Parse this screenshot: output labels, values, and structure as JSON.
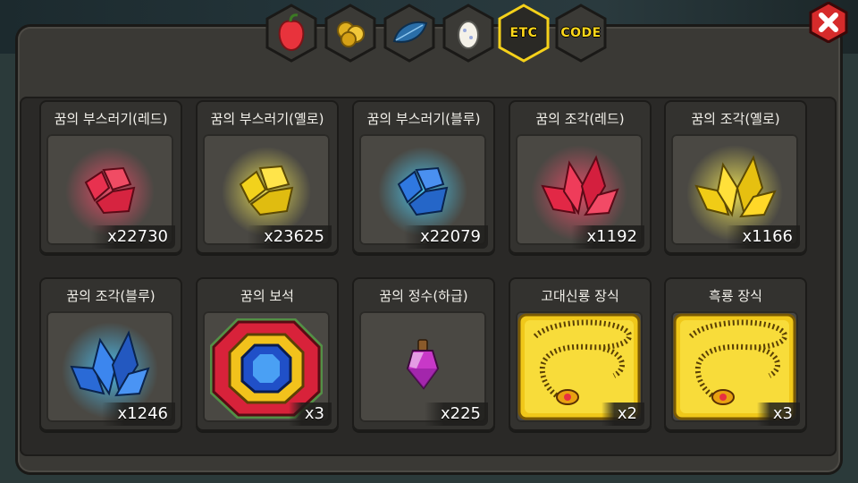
{
  "tabs": [
    {
      "name": "fruit",
      "label": ""
    },
    {
      "name": "gold-coins",
      "label": ""
    },
    {
      "name": "blue-feather",
      "label": ""
    },
    {
      "name": "egg",
      "label": ""
    },
    {
      "name": "etc",
      "label": "ETC",
      "active": true
    },
    {
      "name": "code",
      "label": "CODE"
    }
  ],
  "items": [
    {
      "title": "꿈의 부스러기(레드)",
      "count": "x22730",
      "icon": "red-shard-icon"
    },
    {
      "title": "꿈의 부스러기(옐로)",
      "count": "x23625",
      "icon": "yellow-shard-icon"
    },
    {
      "title": "꿈의 부스러기(블루)",
      "count": "x22079",
      "icon": "blue-shard-icon"
    },
    {
      "title": "꿈의 조각(레드)",
      "count": "x1192",
      "icon": "red-crystal-icon"
    },
    {
      "title": "꿈의 조각(옐로)",
      "count": "x1166",
      "icon": "yellow-crystal-icon"
    },
    {
      "title": "꿈의 조각(블루)",
      "count": "x1246",
      "icon": "blue-crystal-icon"
    },
    {
      "title": "꿈의 보석",
      "count": "x3",
      "icon": "jewel-icon"
    },
    {
      "title": "꿈의 정수(하급)",
      "count": "x225",
      "icon": "potion-icon"
    },
    {
      "title": "고대신룡 장식",
      "count": "x2",
      "icon": "gold-necklace-icon"
    },
    {
      "title": "흑룡 장식",
      "count": "x3",
      "icon": "gold-necklace-icon"
    }
  ],
  "colors": {
    "accent": "#ffd81a",
    "close": "#d62b2b",
    "panel": "#3a3935"
  }
}
